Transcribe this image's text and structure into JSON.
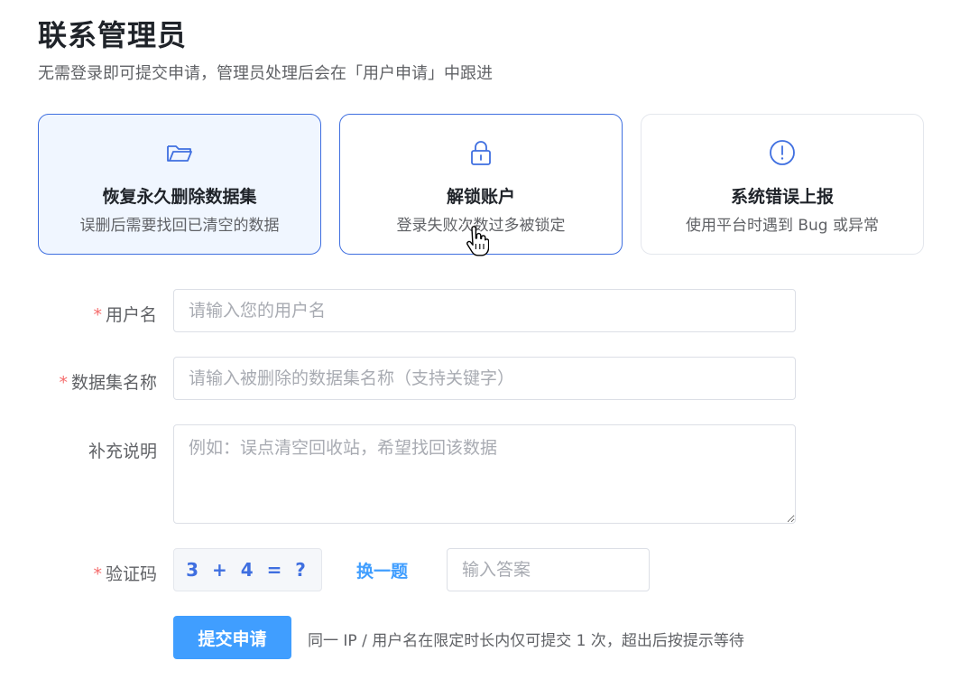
{
  "page": {
    "title": "联系管理员",
    "subtitle": "无需登录即可提交申请，管理员处理后会在「用户申请」中跟进"
  },
  "cards": [
    {
      "icon": "folder-icon",
      "title": "恢复永久删除数据集",
      "desc": "误删后需要找回已清空的数据",
      "state": "selected"
    },
    {
      "icon": "lock-icon",
      "title": "解锁账户",
      "desc": "登录失败次数过多被锁定",
      "state": "hover"
    },
    {
      "icon": "alert-circle-icon",
      "title": "系统错误上报",
      "desc": "使用平台时遇到 Bug 或异常",
      "state": "default"
    }
  ],
  "form": {
    "required_mark": "*",
    "username": {
      "label": "用户名",
      "placeholder": "请输入您的用户名",
      "value": ""
    },
    "dataset": {
      "label": "数据集名称",
      "placeholder": "请输入被删除的数据集名称（支持关键字）",
      "value": ""
    },
    "note": {
      "label": "补充说明",
      "placeholder": "例如：误点清空回收站，希望找回该数据",
      "value": ""
    },
    "captcha": {
      "label": "验证码",
      "question": "3 + 4 = ?",
      "refresh_label": "换一题",
      "placeholder": "输入答案",
      "value": ""
    },
    "submit_label": "提交申请",
    "hint": "同一 IP / 用户名在限定时长内仅可提交 1 次，超出后按提示等待"
  },
  "colors": {
    "accent": "#3f6fe0",
    "primary_button": "#409eff",
    "required": "#f56c6c"
  }
}
